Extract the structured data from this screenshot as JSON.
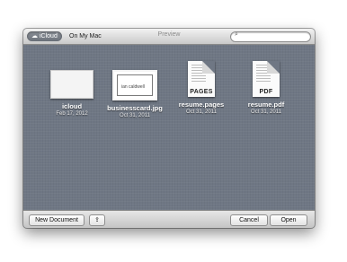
{
  "titlebar": {
    "segments": [
      "iCloud",
      "On My Mac"
    ],
    "title": "Preview",
    "search_placeholder": ""
  },
  "files": [
    {
      "name": "icloud",
      "date": "Feb 17, 2012"
    },
    {
      "name": "businesscard.jpg",
      "date": "Oct 31, 2011",
      "card_text": "ian caldwell"
    },
    {
      "name": "resume.pages",
      "date": "Oct 31, 2011",
      "badge": "PAGES"
    },
    {
      "name": "resume.pdf",
      "date": "Oct 31, 2011",
      "badge": "PDF"
    }
  ],
  "bottombar": {
    "new_document": "New Document",
    "cancel": "Cancel",
    "open": "Open"
  },
  "icons": {
    "cloud": "cloud-icon",
    "search": "search-icon",
    "share": "share-icon"
  }
}
